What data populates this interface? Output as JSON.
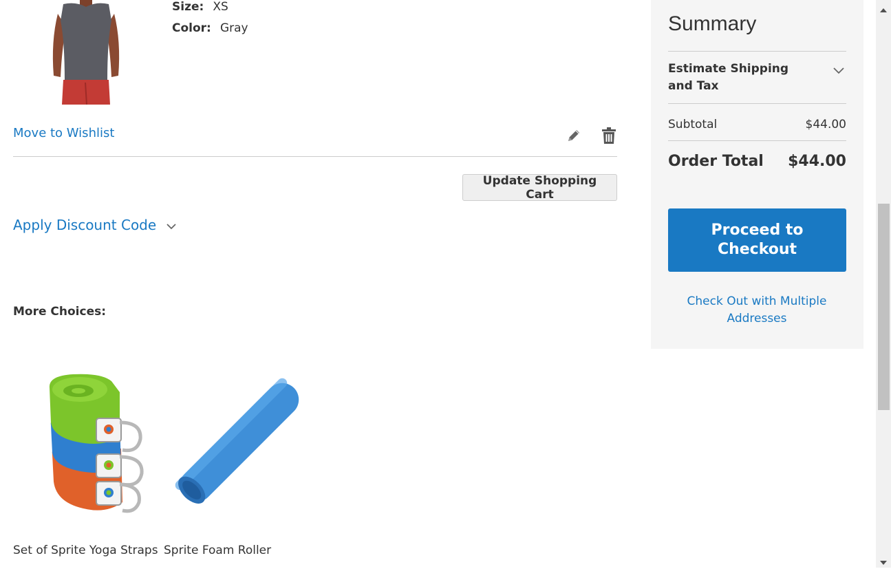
{
  "cart_item": {
    "options": [
      {
        "label": "Size:",
        "value": "XS"
      },
      {
        "label": "Color:",
        "value": "Gray"
      }
    ],
    "move_to_wishlist": "Move to Wishlist",
    "edit_icon": "pencil-icon",
    "delete_icon": "trash-icon"
  },
  "actions": {
    "update_cart": "Update Shopping Cart",
    "apply_discount": "Apply Discount Code"
  },
  "more_choices": {
    "title": "More Choices:",
    "items": [
      {
        "name": "Set of Sprite Yoga Straps"
      },
      {
        "name": "Sprite Foam Roller"
      }
    ]
  },
  "summary": {
    "title": "Summary",
    "estimate_shipping": "Estimate Shipping and Tax",
    "subtotal_label": "Subtotal",
    "subtotal_value": "$44.00",
    "order_total_label": "Order Total",
    "order_total_value": "$44.00",
    "checkout_button": "Proceed to Checkout",
    "multi_address_link": "Check Out with Multiple Addresses"
  },
  "colors": {
    "accent": "#1979c3",
    "panel_bg": "#f5f5f5",
    "text": "#333333"
  }
}
